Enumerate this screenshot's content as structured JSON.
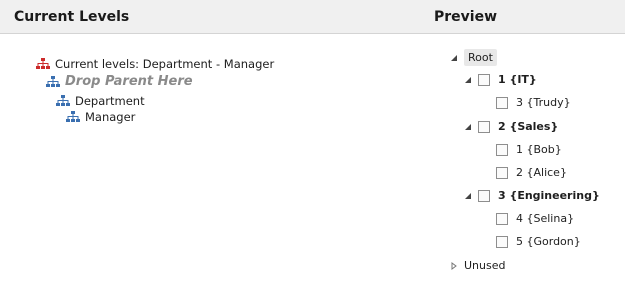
{
  "header": {
    "left_title": "Current Levels",
    "right_title": "Preview"
  },
  "levels": {
    "root_label": "Current levels: Department - Manager",
    "drop_label": "Drop Parent Here",
    "items": [
      "Department",
      "Manager"
    ]
  },
  "preview": {
    "root": "Root",
    "groups": [
      {
        "label": "1 {IT}",
        "children": [
          "3 {Trudy}"
        ]
      },
      {
        "label": "2 {Sales}",
        "children": [
          "1 {Bob}",
          "2 {Alice}"
        ]
      },
      {
        "label": "3 {Engineering}",
        "children": [
          "4 {Selina}",
          "5 {Gordon}"
        ]
      }
    ],
    "unused": "Unused"
  },
  "colors": {
    "hierarchy_red": "#cc2b2b",
    "hierarchy_blue": "#3a6fb0"
  }
}
